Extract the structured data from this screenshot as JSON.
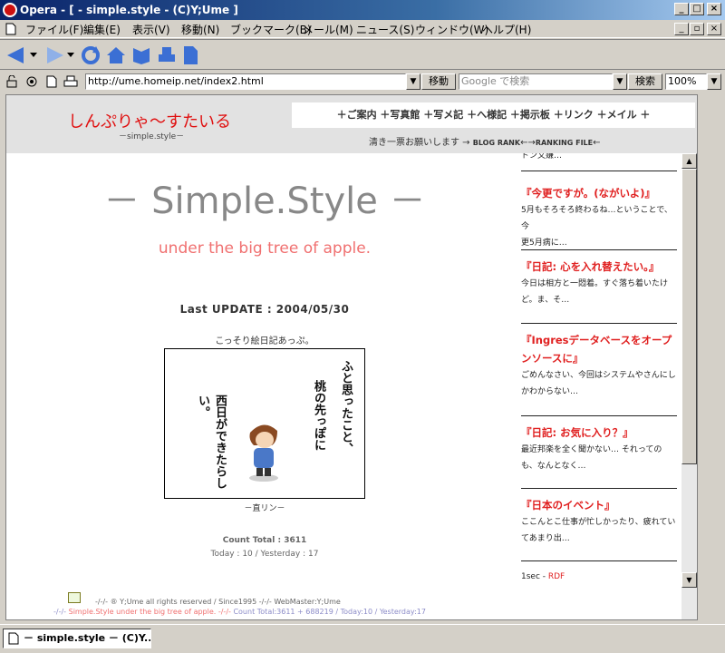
{
  "window": {
    "title": "Opera - [ - simple.style - (C)Y;Ume ]",
    "controls": [
      "_",
      "□",
      "×"
    ]
  },
  "menu": [
    "ファイル(F)",
    "編集(E)",
    "表示(V)",
    "移動(N)",
    "ブックマーク(B)",
    "メール(M)",
    "ニュース(S)",
    "ウィンドウ(W)",
    "ヘルプ(H)"
  ],
  "address": {
    "url": "http://ume.homeip.net/index2.html",
    "go_label": "移動",
    "search_placeholder": "Google で検索",
    "search_label": "検索",
    "zoom": "100%"
  },
  "site": {
    "title": "しんぷりゃ〜すたいる",
    "subtitle": "－simple.style－",
    "nav": "＋ご案内 ＋写真館 ＋写メ記 ＋へ様記 ＋掲示板 ＋リンク ＋メイル ＋",
    "vote_text": "清き一票お願いします →",
    "vote_link1": "BLOG RANK",
    "vote_arrows": "←→",
    "vote_link2": "RANKING FILE",
    "vote_end": "←"
  },
  "main": {
    "big_title": "－ Simple.Style －",
    "tagline": "under the big tree of apple.",
    "last_update": "Last UPDATE : 2004/05/30",
    "picture_caption_top": "こっそり絵日記あっぷ。",
    "picture_text_1": "ふと思ったこと、",
    "picture_text_2": "桃の先っぽに",
    "picture_text_3": "西日ができたらしい。",
    "picture_caption_bottom": "－直リン－",
    "count_total": "Count Total : 3611",
    "today_yesterday": "Today : 10 / Yesterday : 17"
  },
  "footer": {
    "line1": "-/-/- ® Y;Ume all rights reserved / Since1995 -/-/- WebMaster:Y;Ume",
    "line2_prefix": "-/-/-",
    "line2_pink": "Simple.Style under the big tree of apple. -/-/-",
    "line2_rest": "Count Total:3611 + 688219 / Today:10 / Yesterday:17"
  },
  "sidebar": {
    "top_cut": "ドン又嫌…",
    "entries": [
      {
        "title": "『今更ですが。(ながいよ)』",
        "text": [
          "5月もそろそろ終わるね…ということで、今",
          "更5月病に…"
        ]
      },
      {
        "title": "『日記: 心を入れ替えたい。』",
        "text": [
          "今日は相方と一悶着。すぐ落ち着いたけ",
          "ど。ま、そ…"
        ]
      },
      {
        "title": "『Ingresデータベースをオープ",
        "title2": "ンソースに』",
        "text": [
          "ごめんなさい、今回はシステムやさんにし",
          "かわからない…"
        ]
      },
      {
        "title": "『日記: お気に入り？』",
        "text": [
          "最近邦楽を全く聞かない… それっての",
          "も、なんとなく…"
        ]
      },
      {
        "title": "『日本のイベント』",
        "text": [
          "ここんとこ仕事が忙しかったり、疲れてい",
          "てあまり出…"
        ]
      }
    ],
    "rdf_prefix": "1sec - ",
    "rdf_link": "RDF"
  },
  "taskbar": {
    "tab": "－ simple.style － (C)Y..."
  }
}
